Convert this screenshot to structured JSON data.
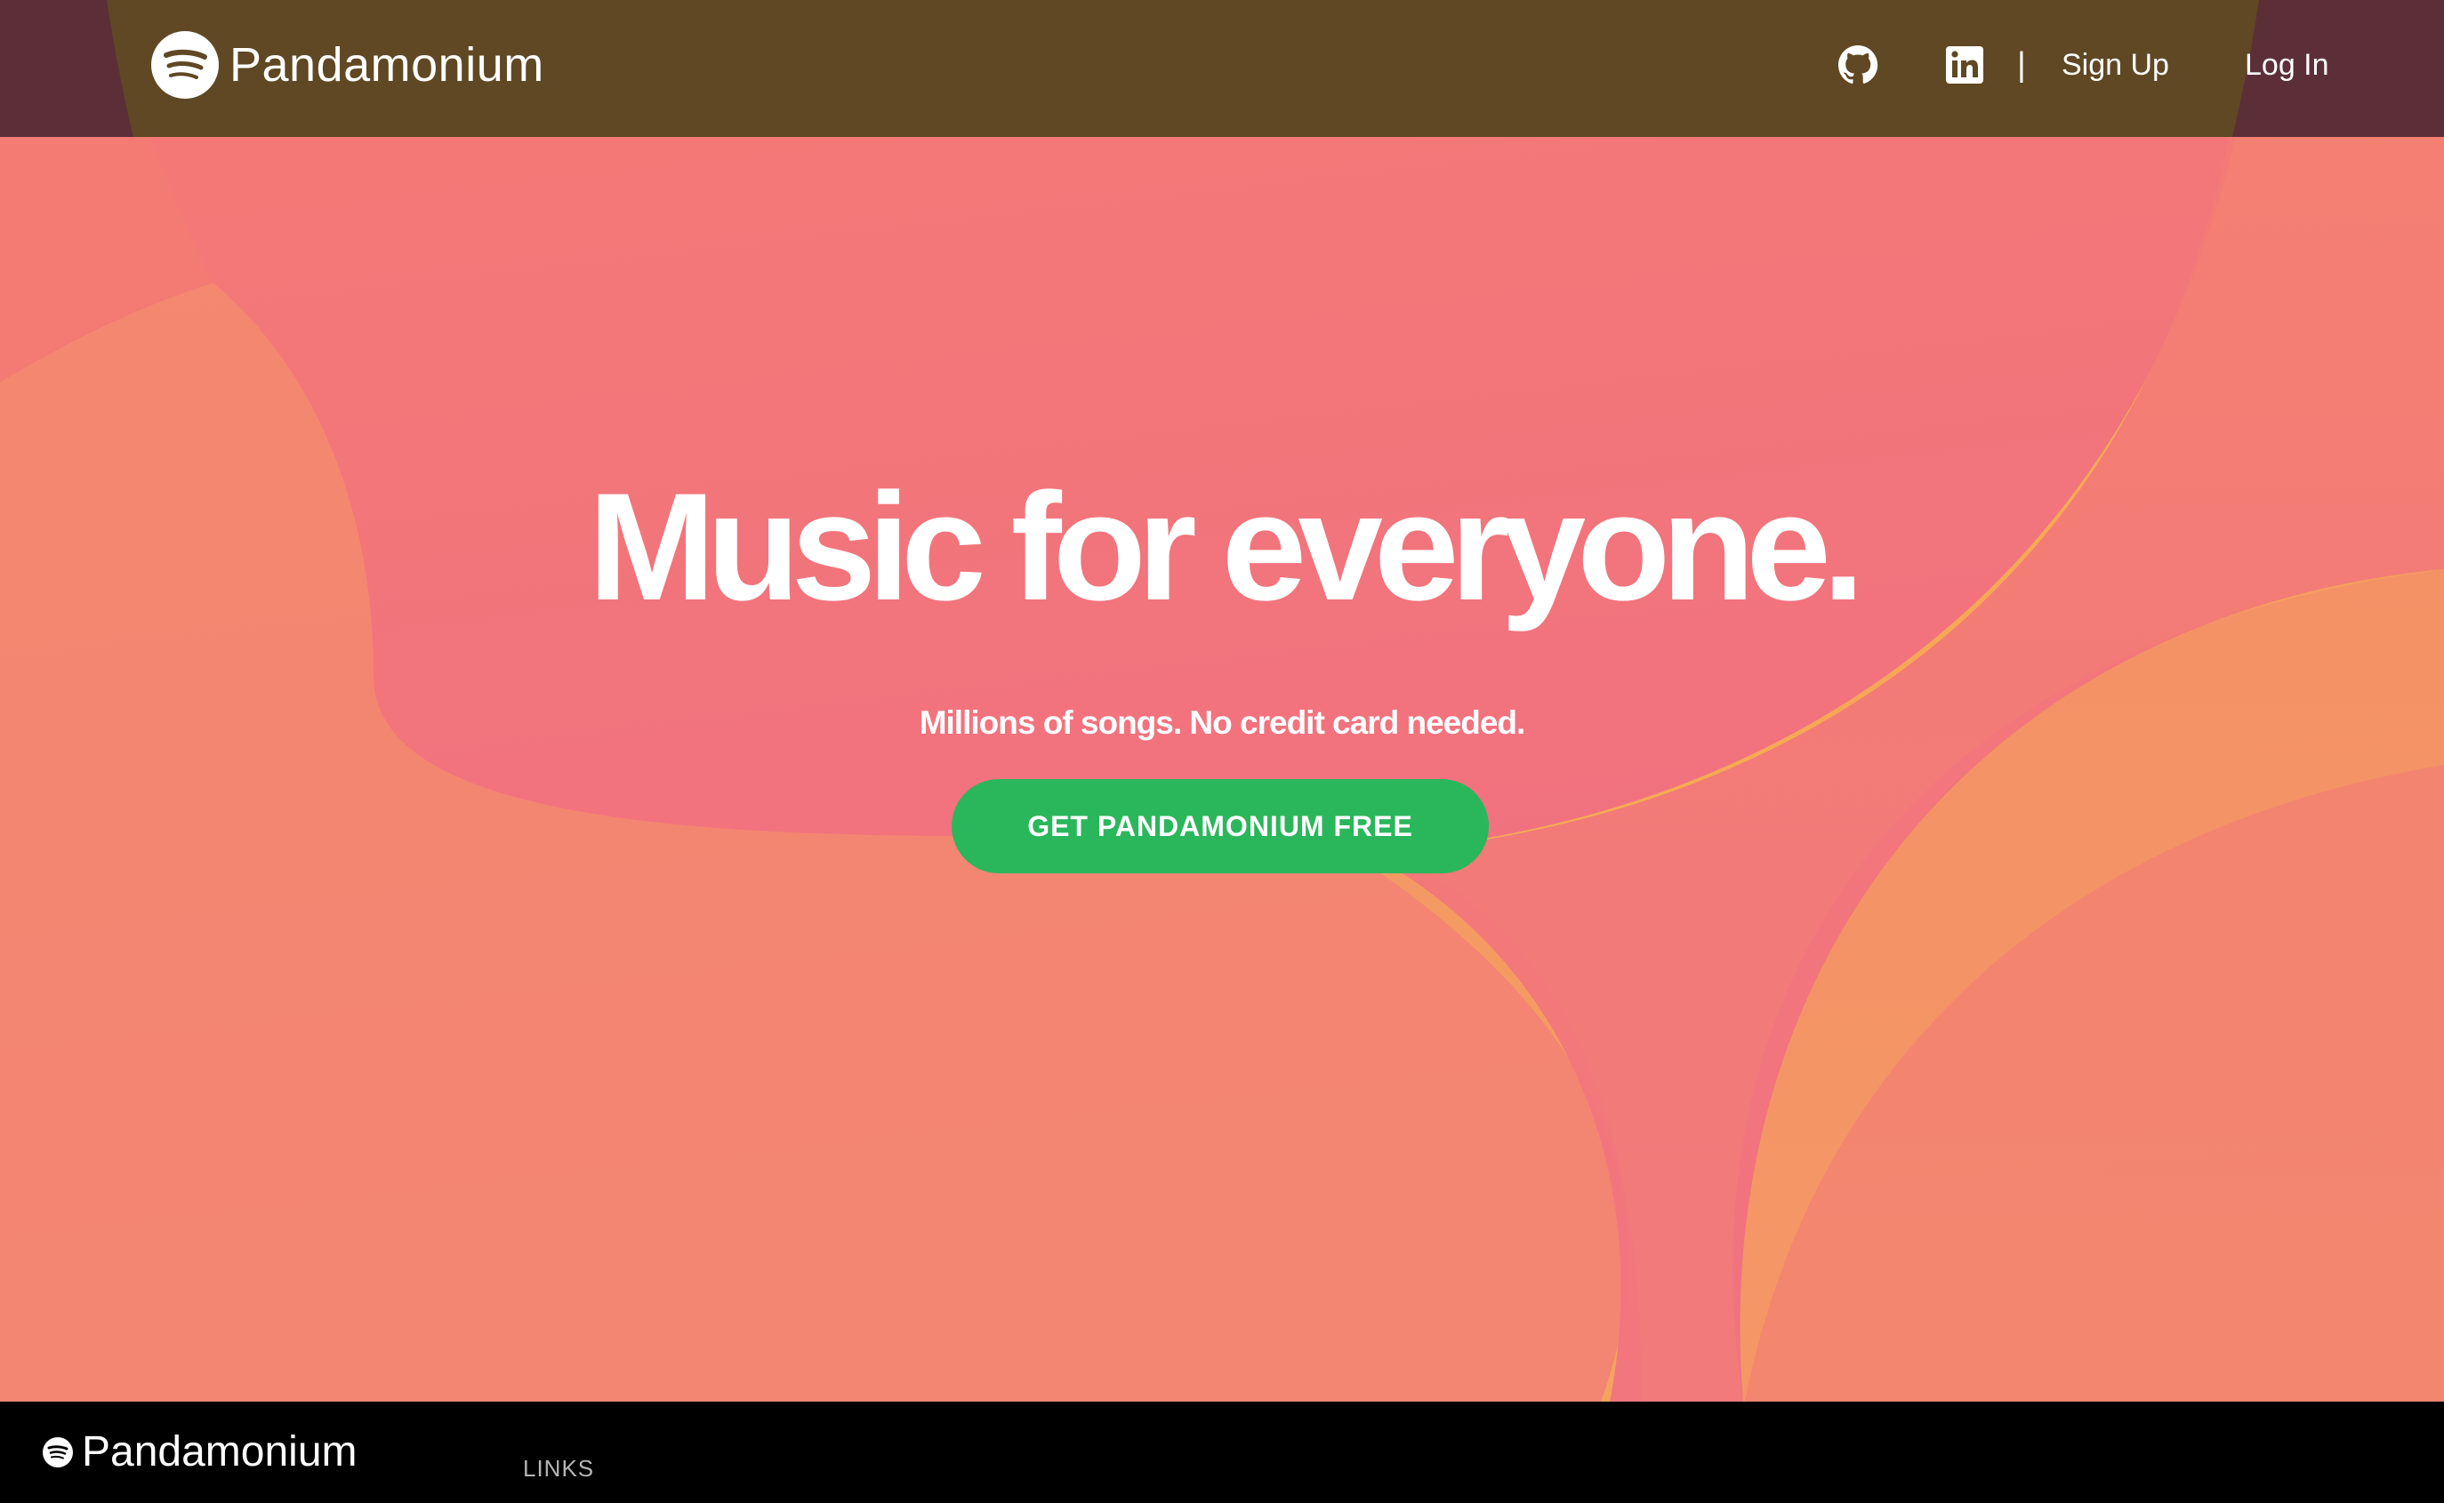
{
  "brand": {
    "name": "Pandamonium",
    "logo_icon": "pandamonium-logo-icon"
  },
  "nav": {
    "github_icon": "github-icon",
    "linkedin_icon": "linkedin-icon",
    "separator": "|",
    "signup_label": "Sign Up",
    "login_label": "Log In"
  },
  "hero": {
    "title": "Music for everyone.",
    "subtitle": "Millions of songs. No credit card needed.",
    "cta_label": "GET PANDAMONIUM FREE"
  },
  "footer": {
    "brand_name": "Pandamonium",
    "links_heading": "LINKS"
  },
  "colors": {
    "nav_background": "#5f4823",
    "hero_orange": "#f7a858",
    "hero_pink": "#f06e84",
    "hero_yellow": "#f8d43c",
    "cta_green": "#2ab75b",
    "footer_background": "#000000",
    "text_white": "#ffffff"
  }
}
